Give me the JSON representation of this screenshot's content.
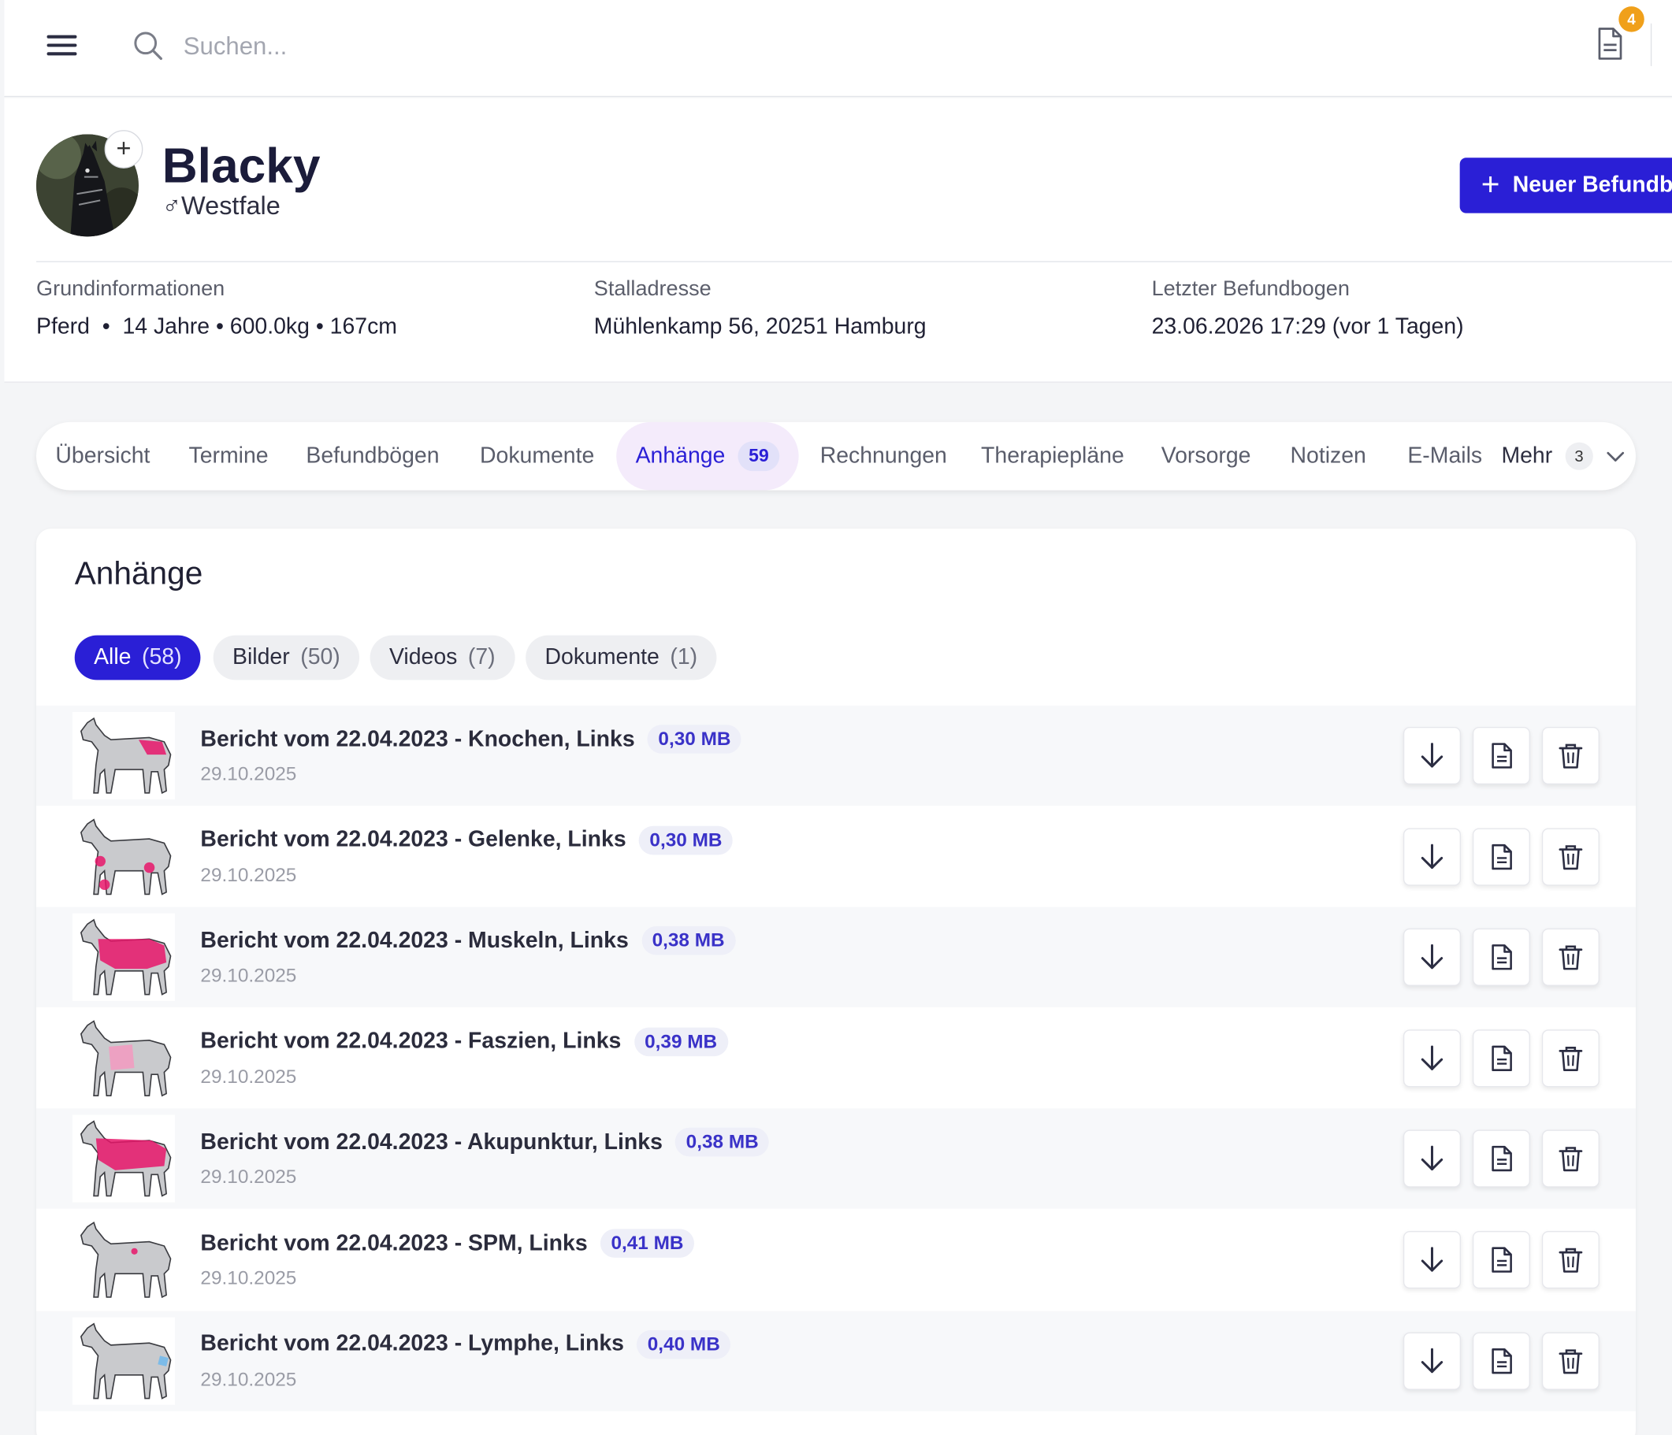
{
  "search": {
    "placeholder": "Suchen..."
  },
  "notifications": {
    "count": "4"
  },
  "horse": {
    "name": "Blacky",
    "gender_symbol": "♂",
    "breed": "Westfale",
    "new_button_label": "Neuer Befundb"
  },
  "info": [
    {
      "label": "Grundinformationen",
      "value": "Pferd  •  14 Jahre • 600.0kg • 167cm"
    },
    {
      "label": "Stalladresse",
      "value": "Mühlenkamp 56, 20251 Hamburg"
    },
    {
      "label": "Letzter Befundbogen",
      "value": "23.06.2026 17:29 (vor 1 Tagen)"
    }
  ],
  "tabs": [
    {
      "label": "Übersicht"
    },
    {
      "label": "Termine"
    },
    {
      "label": "Befundbögen"
    },
    {
      "label": "Dokumente"
    },
    {
      "label": "Anhänge",
      "count": "59",
      "active": true
    },
    {
      "label": "Rechnungen"
    },
    {
      "label": "Therapiepläne"
    },
    {
      "label": "Vorsorge"
    },
    {
      "label": "Notizen"
    },
    {
      "label": "E-Mails"
    },
    {
      "label": "Mehr",
      "count": "3"
    }
  ],
  "attachments": {
    "title": "Anhänge",
    "filters": [
      {
        "label": "Alle",
        "count": "(58)",
        "active": true
      },
      {
        "label": "Bilder",
        "count": "(50)"
      },
      {
        "label": "Videos",
        "count": "(7)"
      },
      {
        "label": "Dokumente",
        "count": "(1)"
      }
    ],
    "items": [
      {
        "title": "Bericht vom 22.04.2023 - Knochen, Links",
        "size": "0,30 MB",
        "date": "29.10.2025",
        "thumb": "horse-skeleton"
      },
      {
        "title": "Bericht vom 22.04.2023 - Gelenke, Links",
        "size": "0,30 MB",
        "date": "29.10.2025",
        "thumb": "horse-joints"
      },
      {
        "title": "Bericht vom 22.04.2023 - Muskeln, Links",
        "size": "0,38 MB",
        "date": "29.10.2025",
        "thumb": "horse-muscles"
      },
      {
        "title": "Bericht vom 22.04.2023 - Faszien, Links",
        "size": "0,39 MB",
        "date": "29.10.2025",
        "thumb": "horse-fascia"
      },
      {
        "title": "Bericht vom 22.04.2023 - Akupunktur, Links",
        "size": "0,38 MB",
        "date": "29.10.2025",
        "thumb": "horse-acupuncture"
      },
      {
        "title": "Bericht vom 22.04.2023 - SPM, Links",
        "size": "0,41 MB",
        "date": "29.10.2025",
        "thumb": "horse-spm"
      },
      {
        "title": "Bericht vom 22.04.2023 - Lymphe, Links",
        "size": "0,40 MB",
        "date": "29.10.2025",
        "thumb": "horse-lymph"
      }
    ]
  },
  "colors": {
    "accent": "#2a1fd6",
    "badge": "#f0a01a",
    "highlight": "#e8166a"
  }
}
